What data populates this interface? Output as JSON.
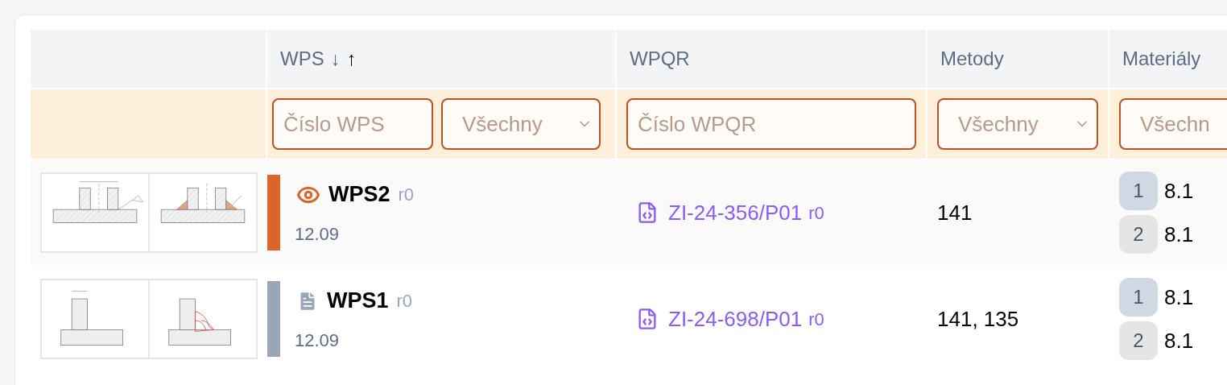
{
  "table": {
    "columns": [
      {
        "label": "WPS",
        "sort_desc": "↓",
        "sort_asc": "↑"
      },
      {
        "label": "WPQR"
      },
      {
        "label": "Metody"
      },
      {
        "label": "Materiály"
      }
    ],
    "filters": [
      {
        "kind": "input",
        "placeholder": "Číslo WPS"
      },
      {
        "kind": "select",
        "value": "Všechny",
        "chevron": true
      },
      {
        "kind": "input",
        "placeholder": "Číslo WPQR"
      },
      {
        "kind": "select",
        "value": "Všechny",
        "chevron": true
      },
      {
        "kind": "select",
        "value": "Všechn"
      }
    ],
    "rows": [
      {
        "thumbnails": [
          {
            "kind": "pipe"
          },
          {
            "kind": "pipe-weld"
          }
        ],
        "kind": "viewed",
        "name": "WPS2",
        "revision": "r0",
        "date": "12.09",
        "wpqr": "ZI-24-356/P01",
        "wpqr_revision": "r0",
        "methods": "141",
        "materials": [
          {
            "index": "1",
            "value": "8.1",
            "color": "#cfd8e3"
          },
          {
            "index": "2",
            "value": "8.1",
            "color": "#e5e5e5"
          }
        ]
      },
      {
        "thumbnails": [
          {
            "kind": "tee"
          },
          {
            "kind": "tee-weld"
          }
        ],
        "kind": "draft",
        "name": "WPS1",
        "revision": "r0",
        "date": "12.09",
        "wpqr": "ZI-24-698/P01",
        "wpqr_revision": "r0",
        "methods": "141, 135",
        "materials": [
          {
            "index": "1",
            "value": "8.1",
            "color": "#cfd8e3"
          },
          {
            "index": "2",
            "value": "8.1",
            "color": "#e5e5e5"
          }
        ]
      }
    ]
  }
}
